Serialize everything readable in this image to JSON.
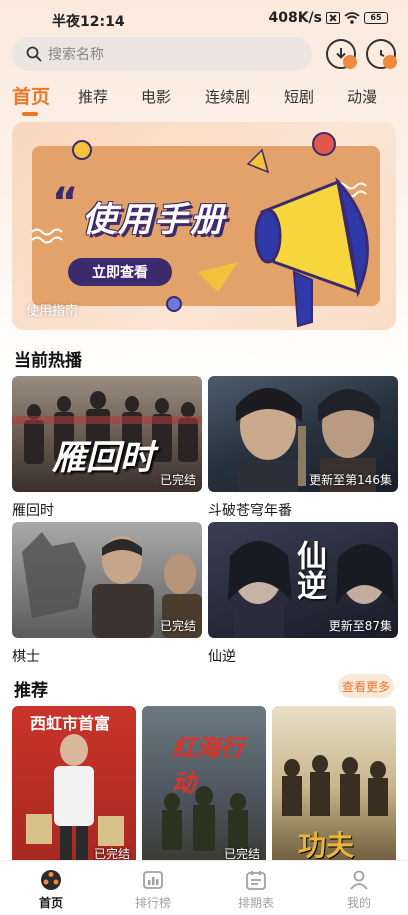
{
  "status_bar": {
    "time": "半夜12:14",
    "network_speed": "408K/s",
    "battery": "65"
  },
  "search": {
    "placeholder": "搜索名称"
  },
  "tabs": [
    {
      "label": "首页",
      "active": true
    },
    {
      "label": "推荐"
    },
    {
      "label": "电影"
    },
    {
      "label": "连续剧"
    },
    {
      "label": "短剧"
    },
    {
      "label": "动漫"
    }
  ],
  "banner": {
    "title": "使用手册",
    "quote_mark": "“",
    "cta": "立即查看",
    "caption": "使用指南"
  },
  "now_playing": {
    "title": "当前热播",
    "items": [
      {
        "name": "雁回时",
        "status": "已完结",
        "poster_text": "雁回时"
      },
      {
        "name": "斗破苍穹年番",
        "status": "更新至第146集"
      },
      {
        "name": "棋士",
        "status": "已完结"
      },
      {
        "name": "仙逆",
        "status": "更新至87集",
        "poster_text": "仙逆"
      }
    ]
  },
  "recommend": {
    "title": "推荐",
    "more": "查看更多",
    "items": [
      {
        "poster_text": "西虹市首富",
        "status": "已完结"
      },
      {
        "poster_text": "红海行动",
        "status": "已完结"
      },
      {
        "poster_text": "功夫"
      }
    ]
  },
  "bottom_nav": [
    {
      "label": "首页",
      "active": true
    },
    {
      "label": "排行榜"
    },
    {
      "label": "排期表"
    },
    {
      "label": "我的"
    }
  ],
  "colors": {
    "accent": "#e8782a",
    "banner_ink": "#3b2a6e"
  }
}
